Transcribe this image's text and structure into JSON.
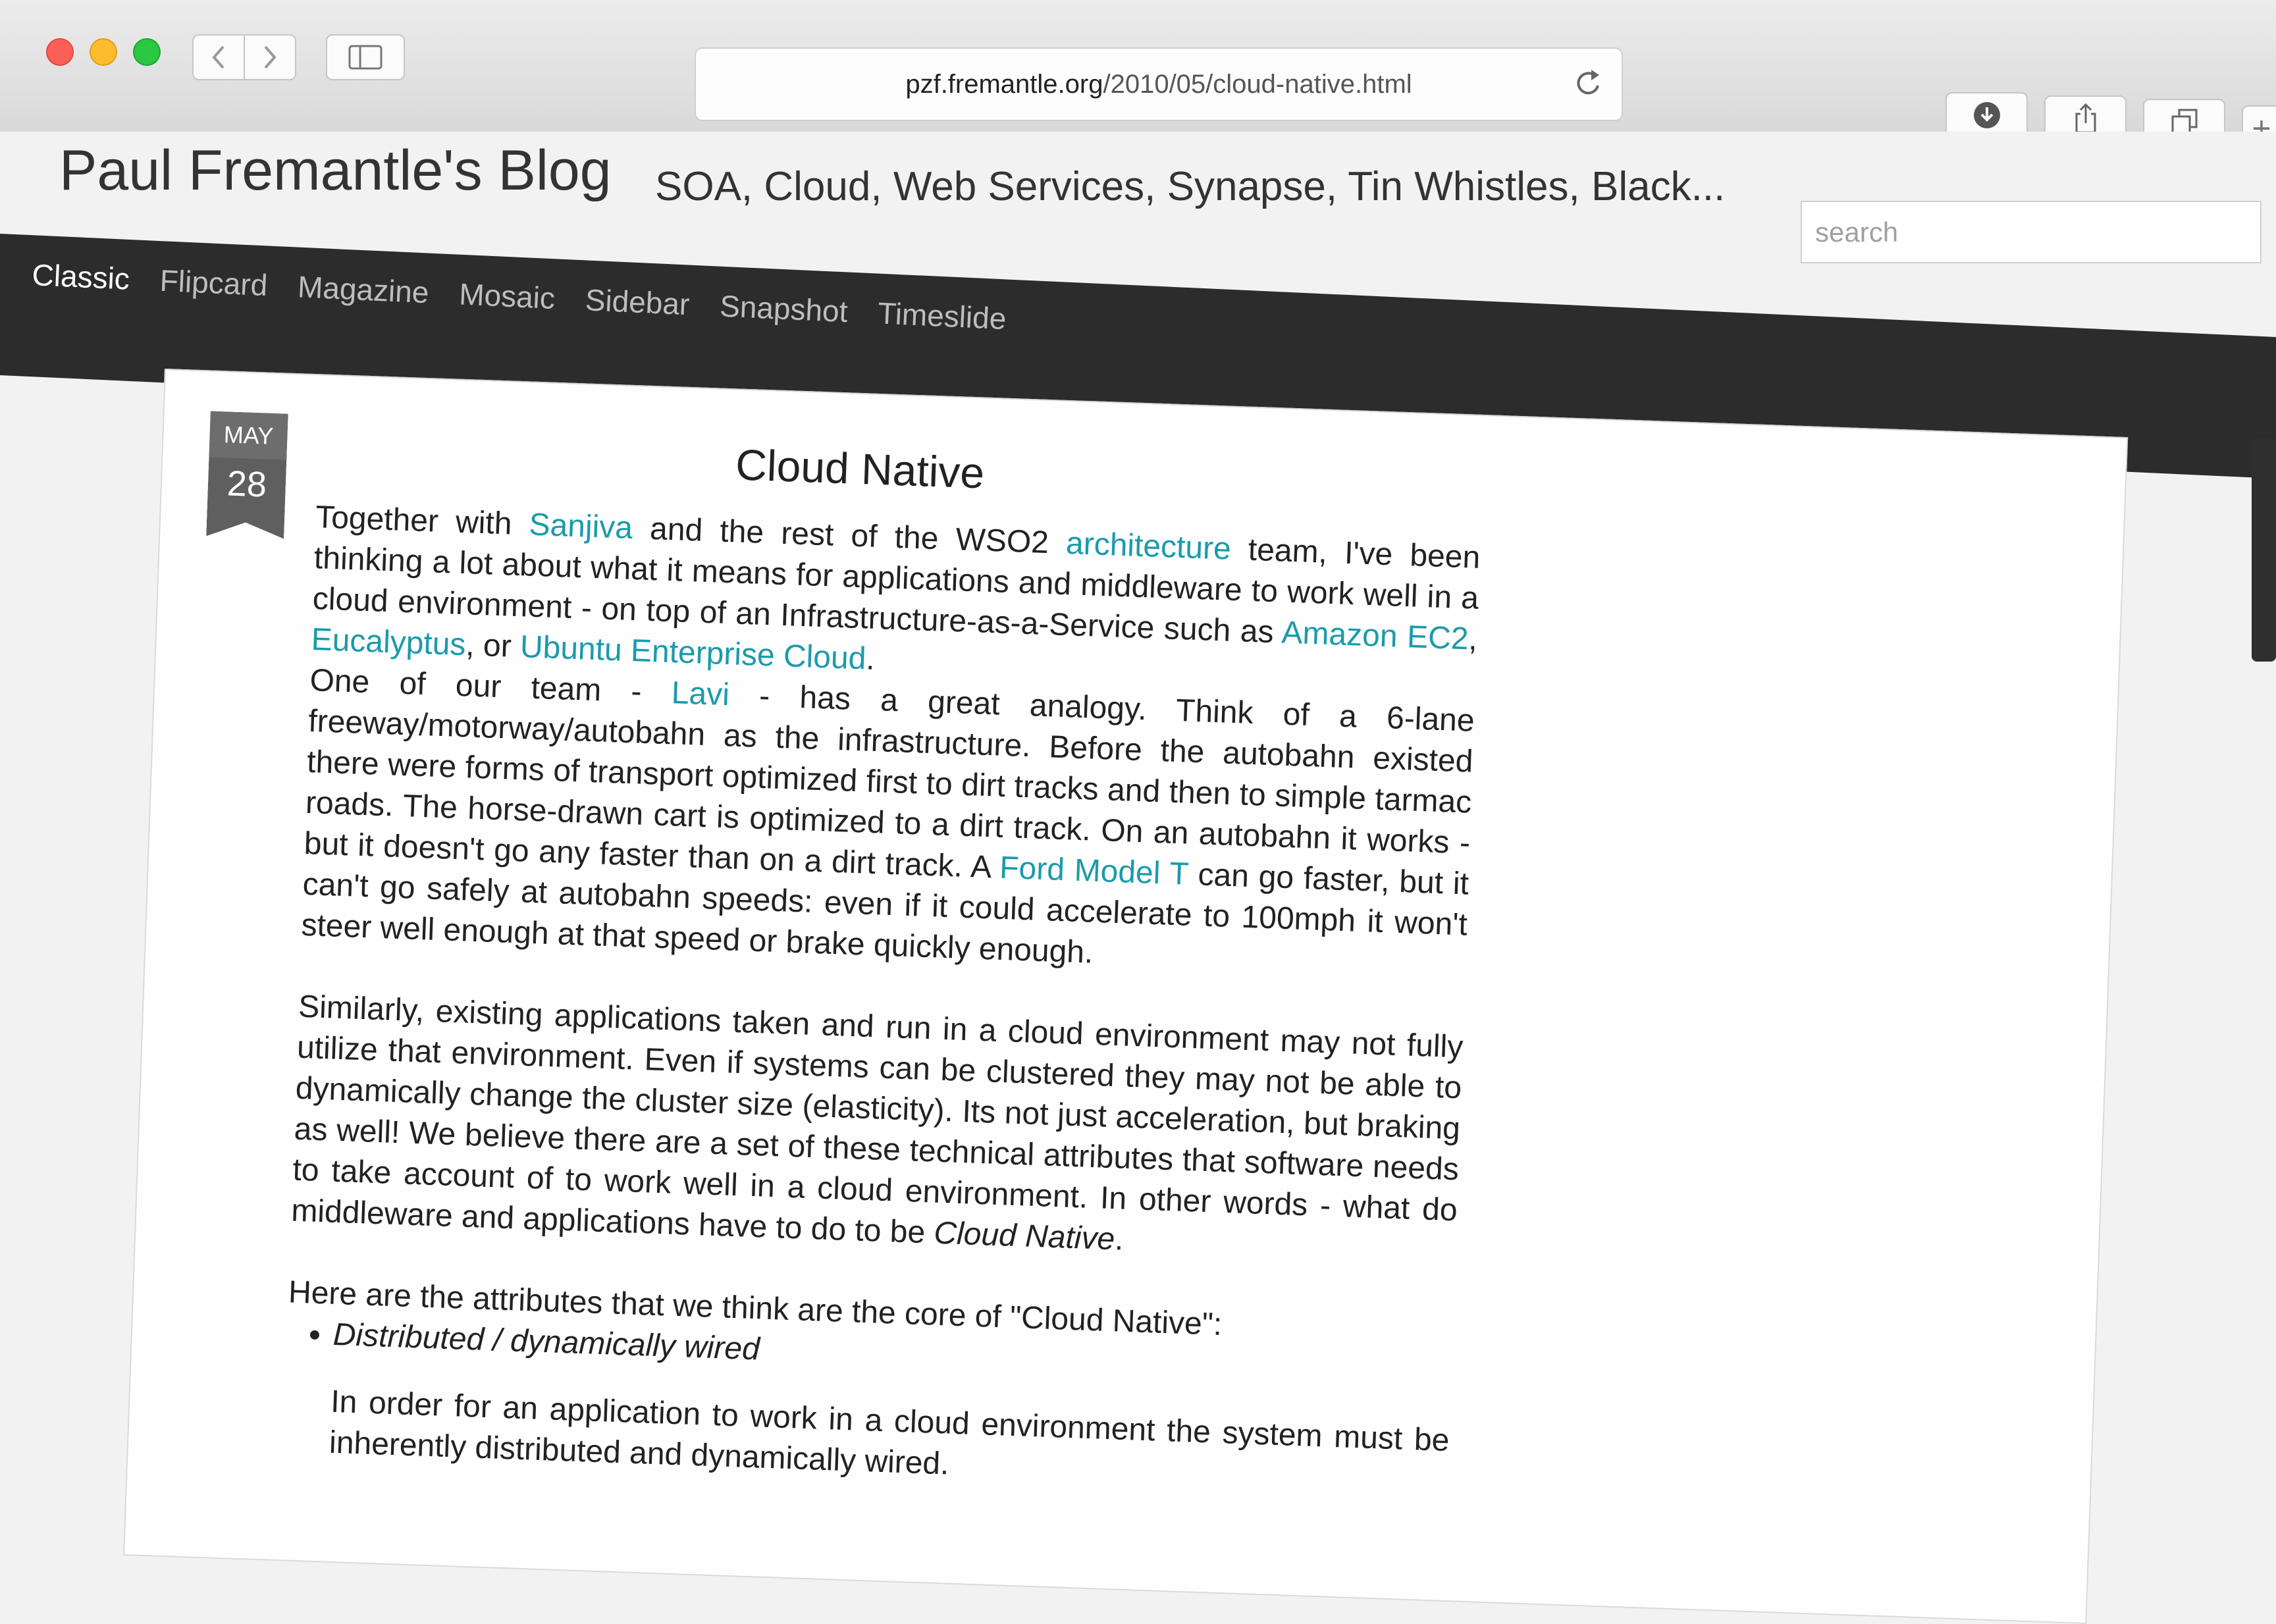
{
  "browser": {
    "url_domain": "pzf.fremantle.org",
    "url_path": "/2010/05/cloud-native.html"
  },
  "header": {
    "title": "Paul Fremantle's Blog",
    "tagline": "SOA, Cloud, Web Services, Synapse, Tin Whistles, Black..."
  },
  "search": {
    "placeholder": "search"
  },
  "nav": {
    "items": [
      "Classic",
      "Flipcard",
      "Magazine",
      "Mosaic",
      "Sidebar",
      "Snapshot",
      "Timeslide"
    ],
    "active": "Classic"
  },
  "post": {
    "date_month": "MAY",
    "date_day": "28",
    "title": "Cloud Native",
    "p1": {
      "t1": "Together with ",
      "link_sanjiva": "Sanjiva",
      "t2": " and the rest of the WSO2 ",
      "link_architecture": "architecture",
      "t3": " team, I've been thinking a lot about what it means for applications and middleware to work well in a cloud environment - on top of an Infrastructure-as-a-Service such as ",
      "link_ec2": "Amazon EC2",
      "t4": ", ",
      "link_eucalyptus": "Eucalyptus",
      "t5": ", or ",
      "link_ubuntu": "Ubuntu Enterprise Cloud",
      "t6": "."
    },
    "p2": {
      "t1": "One of our team - ",
      "link_lavi": "Lavi",
      "t2": " - has a great analogy. Think of a 6-lane freeway/motorway/autobahn as the infrastructure. Before the autobahn existed there were forms of transport optimized first to dirt tracks and then to simple tarmac roads. The horse-drawn cart is optimized to a dirt track. On an autobahn it works - but it doesn't go any faster than on a dirt track. A ",
      "link_ford": "Ford Model T",
      "t3": " can go faster, but it can't go safely at autobahn speeds: even if it could accelerate to 100mph it won't steer well enough at that speed or brake quickly enough."
    },
    "p3": {
      "t1": "Similarly, existing applications taken and run in a cloud environment may not fully utilize that environment. Even if systems can be clustered they may not be able to dynamically change the cluster size (elasticity). Its not just acceleration, but braking as well! We believe there are a set of these technical attributes that software needs to take account of to work well in a cloud environment. In other words - what do middleware and applications have to do to be ",
      "emph": "Cloud Native",
      "t2": "."
    },
    "p4": "Here are the attributes that we think are the core of \"Cloud Native\":",
    "bullet1": "Distributed / dynamically wired",
    "p5": "In order for an application to work in a cloud environment the system must be inherently distributed and dynamically wired."
  }
}
